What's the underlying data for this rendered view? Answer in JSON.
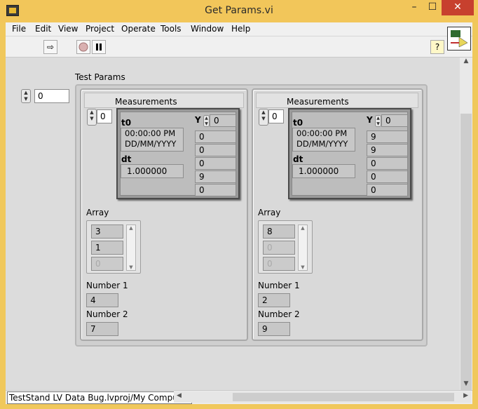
{
  "window": {
    "title": "Get Params.vi",
    "minimize": "–",
    "maximize": "☐",
    "close": "✕"
  },
  "menu": [
    "File",
    "Edit",
    "View",
    "Project",
    "Operate",
    "Tools",
    "Window",
    "Help"
  ],
  "toolbar": {
    "run": "⇨",
    "help": "?",
    "vi_icon_text": "VI"
  },
  "front_panel": {
    "index_value": "0",
    "test_params_label": "Test Params",
    "elements": [
      {
        "measurements_label": "Measurements",
        "meas_index": "0",
        "t0_label": "t0",
        "t0_time": "00:00:00 PM",
        "t0_date": "DD/MM/YYYY",
        "dt_label": "dt",
        "dt_value": "1.000000",
        "y_label": "Y",
        "y_index": "0",
        "y_values": [
          "0",
          "0",
          "0",
          "9",
          "0"
        ],
        "array_label": "Array",
        "array_values": [
          "3",
          "1",
          "0"
        ],
        "number1_label": "Number 1",
        "number1_value": "4",
        "number2_label": "Number 2",
        "number2_value": "7"
      },
      {
        "measurements_label": "Measurements",
        "meas_index": "0",
        "t0_label": "t0",
        "t0_time": "00:00:00 PM",
        "t0_date": "DD/MM/YYYY",
        "dt_label": "dt",
        "dt_value": "1.000000",
        "y_label": "Y",
        "y_index": "0",
        "y_values": [
          "9",
          "9",
          "0",
          "0",
          "0"
        ],
        "array_label": "Array",
        "array_values": [
          "8",
          "0",
          "0"
        ],
        "number1_label": "Number 1",
        "number1_value": "2",
        "number2_label": "Number 2",
        "number2_value": "9"
      }
    ]
  },
  "status": {
    "path": "TestStand LV Data Bug.lvproj/My Computer"
  }
}
